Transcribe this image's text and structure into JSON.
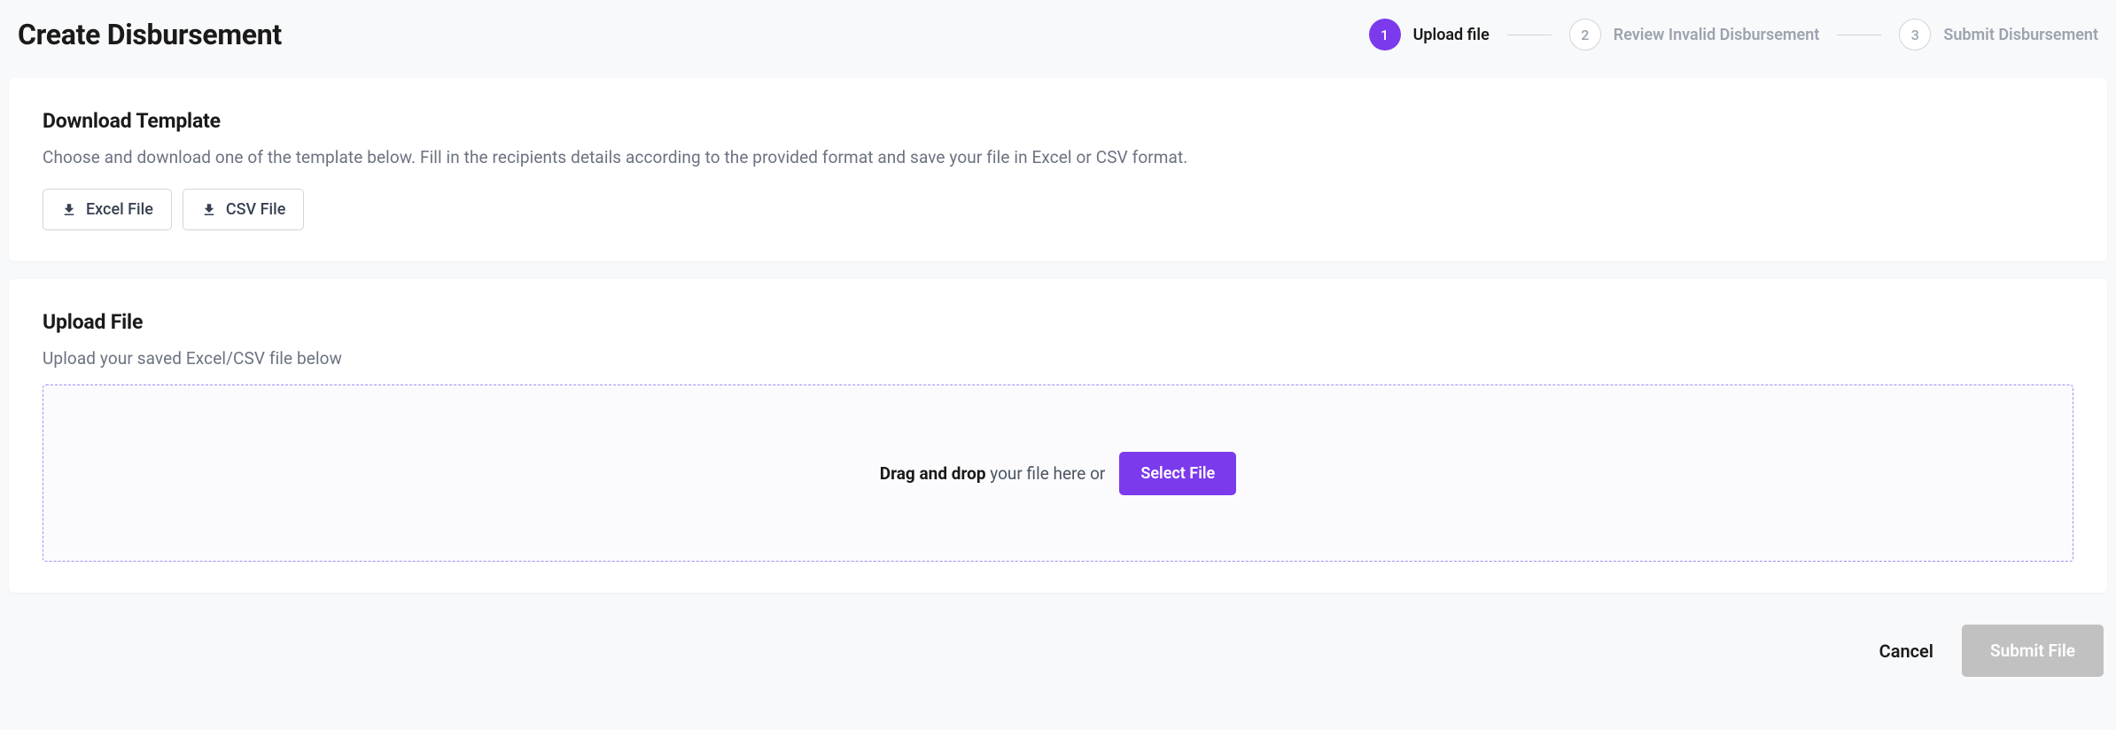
{
  "page": {
    "title": "Create Disbursement"
  },
  "stepper": {
    "steps": [
      {
        "number": "1",
        "label": "Upload file",
        "active": true
      },
      {
        "number": "2",
        "label": "Review Invalid Disbursement",
        "active": false
      },
      {
        "number": "3",
        "label": "Submit Disbursement",
        "active": false
      }
    ]
  },
  "download_card": {
    "title": "Download Template",
    "description": "Choose and download one of the template below. Fill in the recipients details according to the provided format and save your file in Excel or CSV format.",
    "excel_button": "Excel File",
    "csv_button": "CSV File"
  },
  "upload_card": {
    "title": "Upload File",
    "description": "Upload your saved Excel/CSV file below",
    "dropzone_bold": "Drag and drop",
    "dropzone_rest": " your file here or ",
    "select_button": "Select File"
  },
  "footer": {
    "cancel": "Cancel",
    "submit": "Submit File"
  }
}
